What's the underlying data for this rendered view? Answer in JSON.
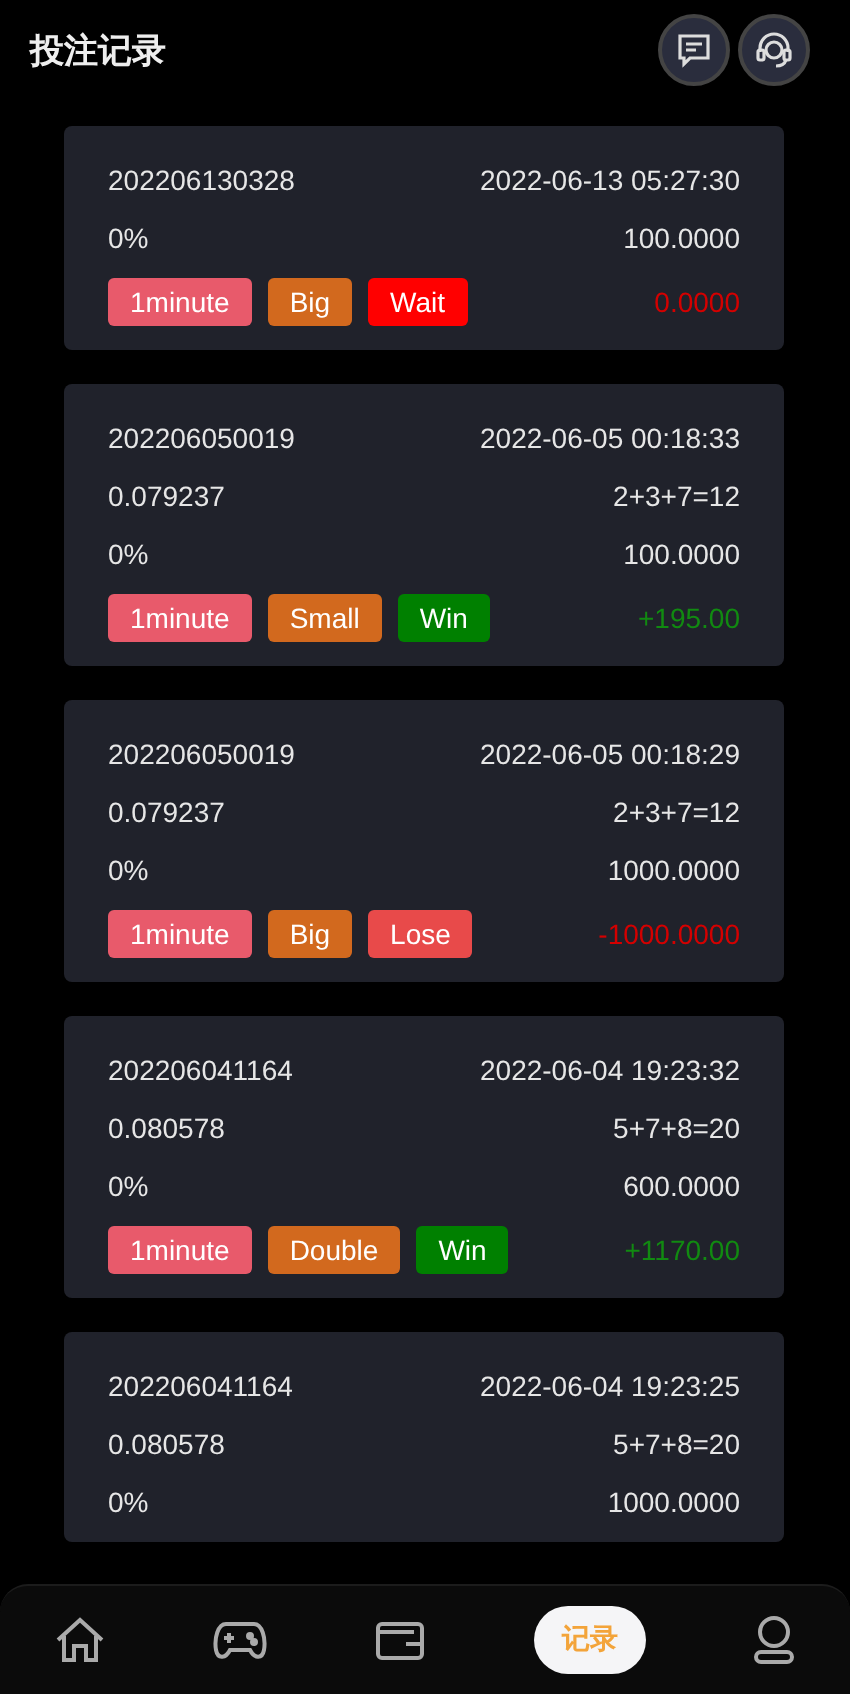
{
  "header": {
    "title": "投注记录"
  },
  "bets": [
    {
      "id": "202206130328",
      "time": "2022-06-13 05:27:30",
      "percent": "0%",
      "stake": "100.0000",
      "kind": "pending",
      "amount": "0.0000",
      "tags": [
        {
          "label": "1minute",
          "color": "#e85a6b"
        },
        {
          "label": "Big",
          "color": "#d2691e"
        },
        {
          "label": "Wait",
          "color": "#ff0000"
        }
      ]
    },
    {
      "id": "202206050019",
      "time": "2022-06-05 00:18:33",
      "rate": "0.079237",
      "formula": "2+3+7=12",
      "percent": "0%",
      "stake": "100.0000",
      "kind": "win",
      "amount": "+195.00",
      "tags": [
        {
          "label": "1minute",
          "color": "#e85a6b"
        },
        {
          "label": "Small",
          "color": "#d2691e"
        },
        {
          "label": "Win",
          "color": "#008000"
        }
      ]
    },
    {
      "id": "202206050019",
      "time": "2022-06-05 00:18:29",
      "rate": "0.079237",
      "formula": "2+3+7=12",
      "percent": "0%",
      "stake": "1000.0000",
      "kind": "lose",
      "amount": "-1000.0000",
      "tags": [
        {
          "label": "1minute",
          "color": "#e85a6b"
        },
        {
          "label": "Big",
          "color": "#d2691e"
        },
        {
          "label": "Lose",
          "color": "#e84a4a"
        }
      ]
    },
    {
      "id": "202206041164",
      "time": "2022-06-04 19:23:32",
      "rate": "0.080578",
      "formula": "5+7+8=20",
      "percent": "0%",
      "stake": "600.0000",
      "kind": "win",
      "amount": "+1170.00",
      "tags": [
        {
          "label": "1minute",
          "color": "#e85a6b"
        },
        {
          "label": "Double",
          "color": "#d2691e"
        },
        {
          "label": "Win",
          "color": "#008000"
        }
      ]
    },
    {
      "id": "202206041164",
      "time": "2022-06-04 19:23:25",
      "rate": "0.080578",
      "formula": "5+7+8=20",
      "percent": "0%",
      "stake": "1000.0000"
    }
  ],
  "nav": [
    {
      "kind": "home",
      "selected": false
    },
    {
      "kind": "game",
      "selected": false
    },
    {
      "kind": "wallet",
      "selected": false
    },
    {
      "kind": "record",
      "label": "记录",
      "selected": true
    },
    {
      "kind": "user",
      "selected": false
    }
  ]
}
